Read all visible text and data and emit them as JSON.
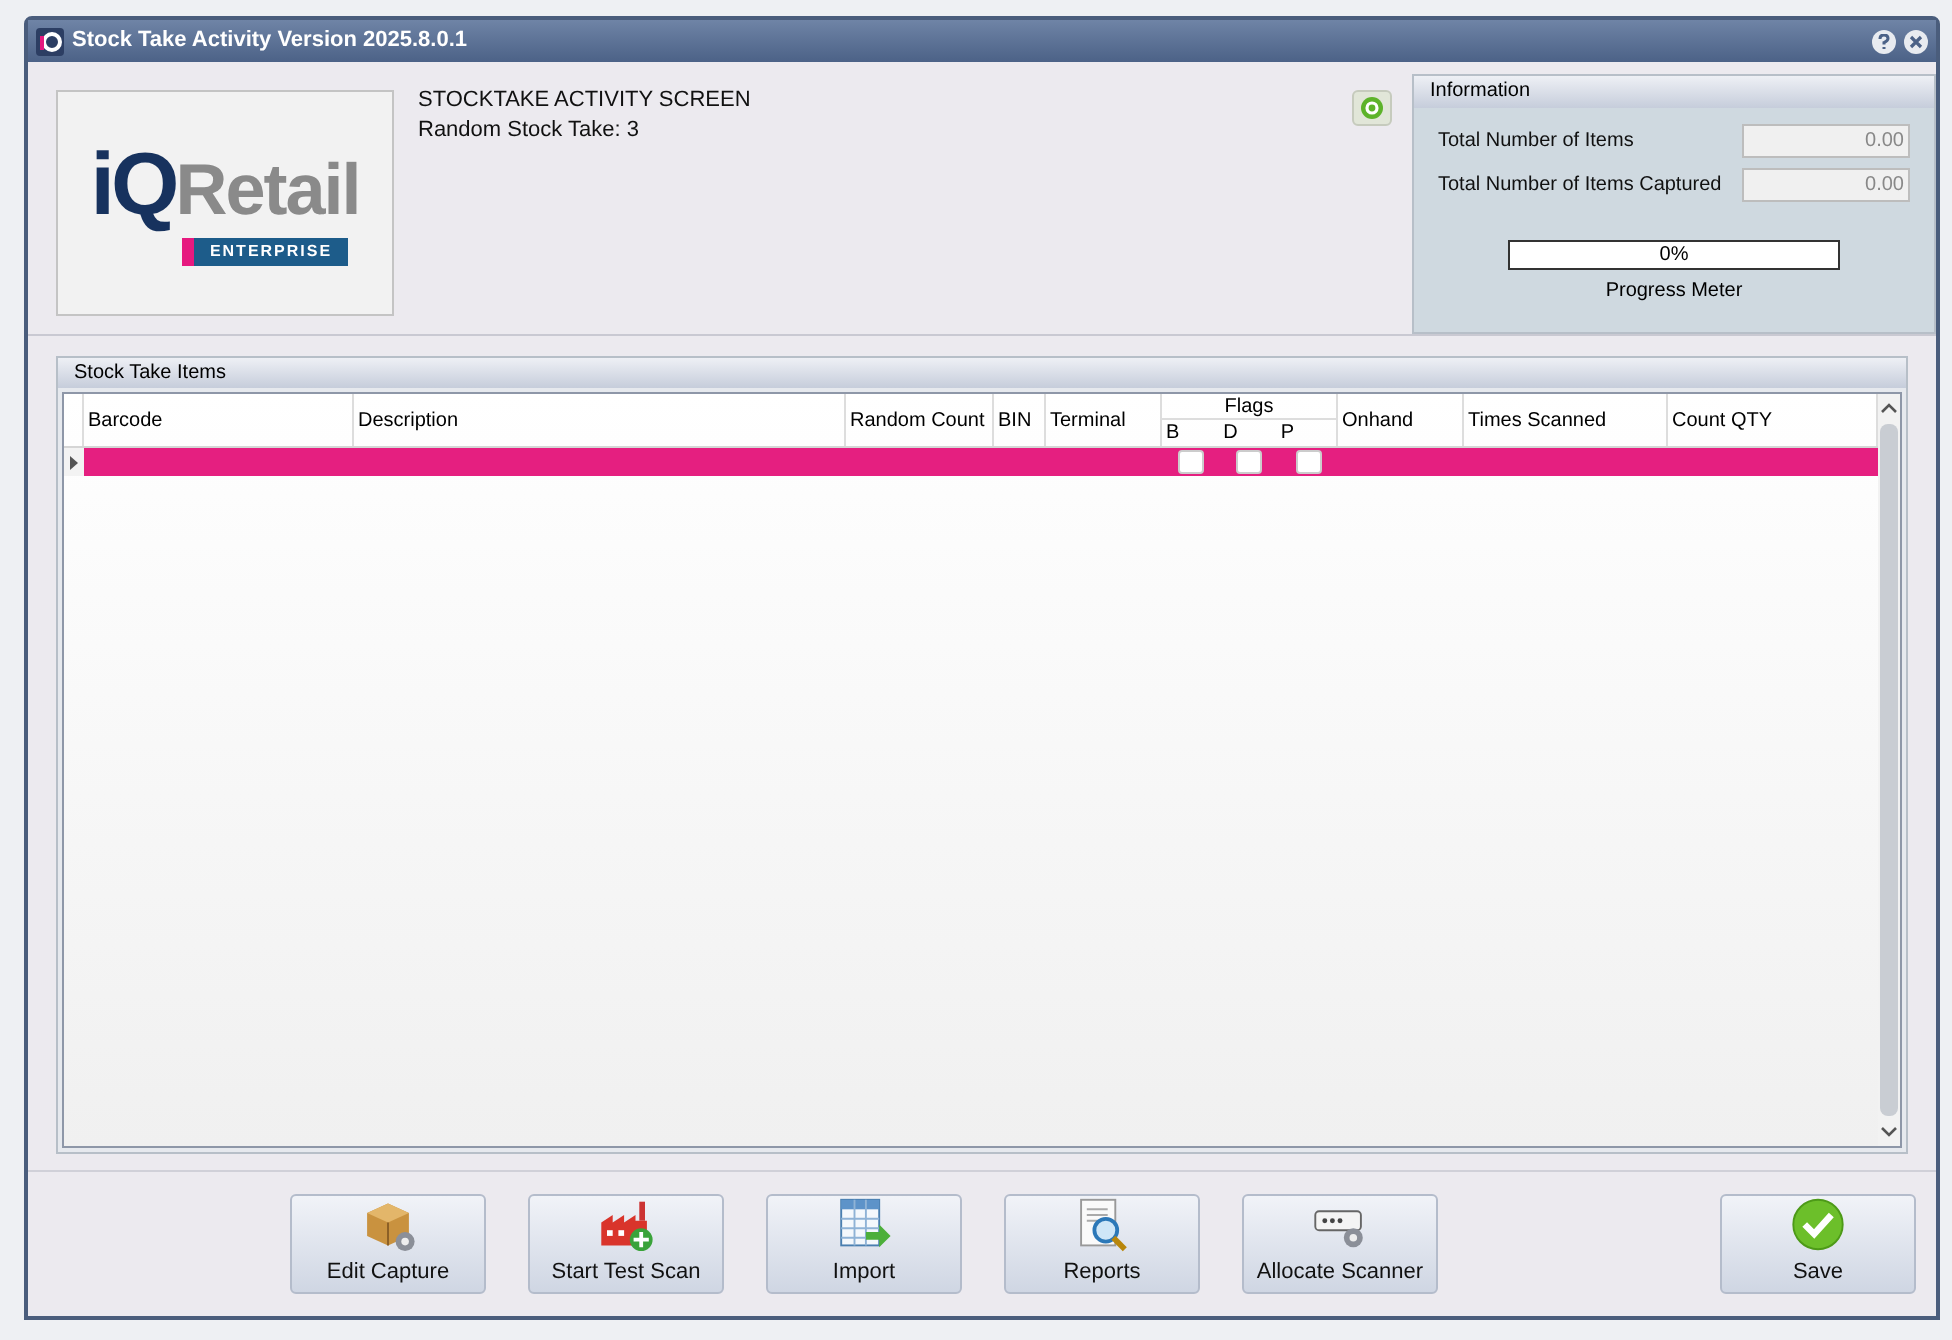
{
  "window": {
    "title": "Stock Take Activity Version 2025.8.0.1"
  },
  "logo": {
    "brand_a": "iQ",
    "brand_b": "Retail",
    "edition": "ENTERPRISE"
  },
  "header": {
    "heading": "STOCKTAKE ACTIVITY SCREEN",
    "subheading": "Random Stock Take: 3"
  },
  "information": {
    "title": "Information",
    "fields": [
      {
        "label": "Total Number of Items",
        "value": "0.00"
      },
      {
        "label": "Total Number of Items Captured",
        "value": "0.00"
      }
    ],
    "progress": {
      "level": 0,
      "reading": "0%",
      "label": "Progress Meter"
    }
  },
  "table": {
    "title": "Stock Take Items",
    "flags_group": "Flags",
    "columns": [
      {
        "label": "Barcode",
        "kind": "text"
      },
      {
        "label": "Description",
        "kind": "text"
      },
      {
        "label": "Random Count",
        "kind": "text"
      },
      {
        "label": "BIN",
        "kind": "text"
      },
      {
        "label": "Terminal",
        "kind": "text"
      },
      {
        "label": "B",
        "kind": "flag"
      },
      {
        "label": "D",
        "kind": "flag"
      },
      {
        "label": "P",
        "kind": "flag"
      },
      {
        "label": "Onhand",
        "kind": "text"
      },
      {
        "label": "Times Scanned",
        "kind": "text"
      },
      {
        "label": "Count QTY",
        "kind": "text"
      }
    ],
    "rows": [
      {
        "selected": true,
        "flags": [
          {
            "checked": false
          },
          {
            "checked": false
          },
          {
            "checked": false
          }
        ]
      }
    ]
  },
  "buttons": [
    {
      "label": "Edit Capture"
    },
    {
      "label": "Start Test Scan"
    },
    {
      "label": "Import"
    },
    {
      "label": "Reports"
    },
    {
      "label": "Allocate Scanner"
    },
    {
      "label": "Save"
    }
  ]
}
